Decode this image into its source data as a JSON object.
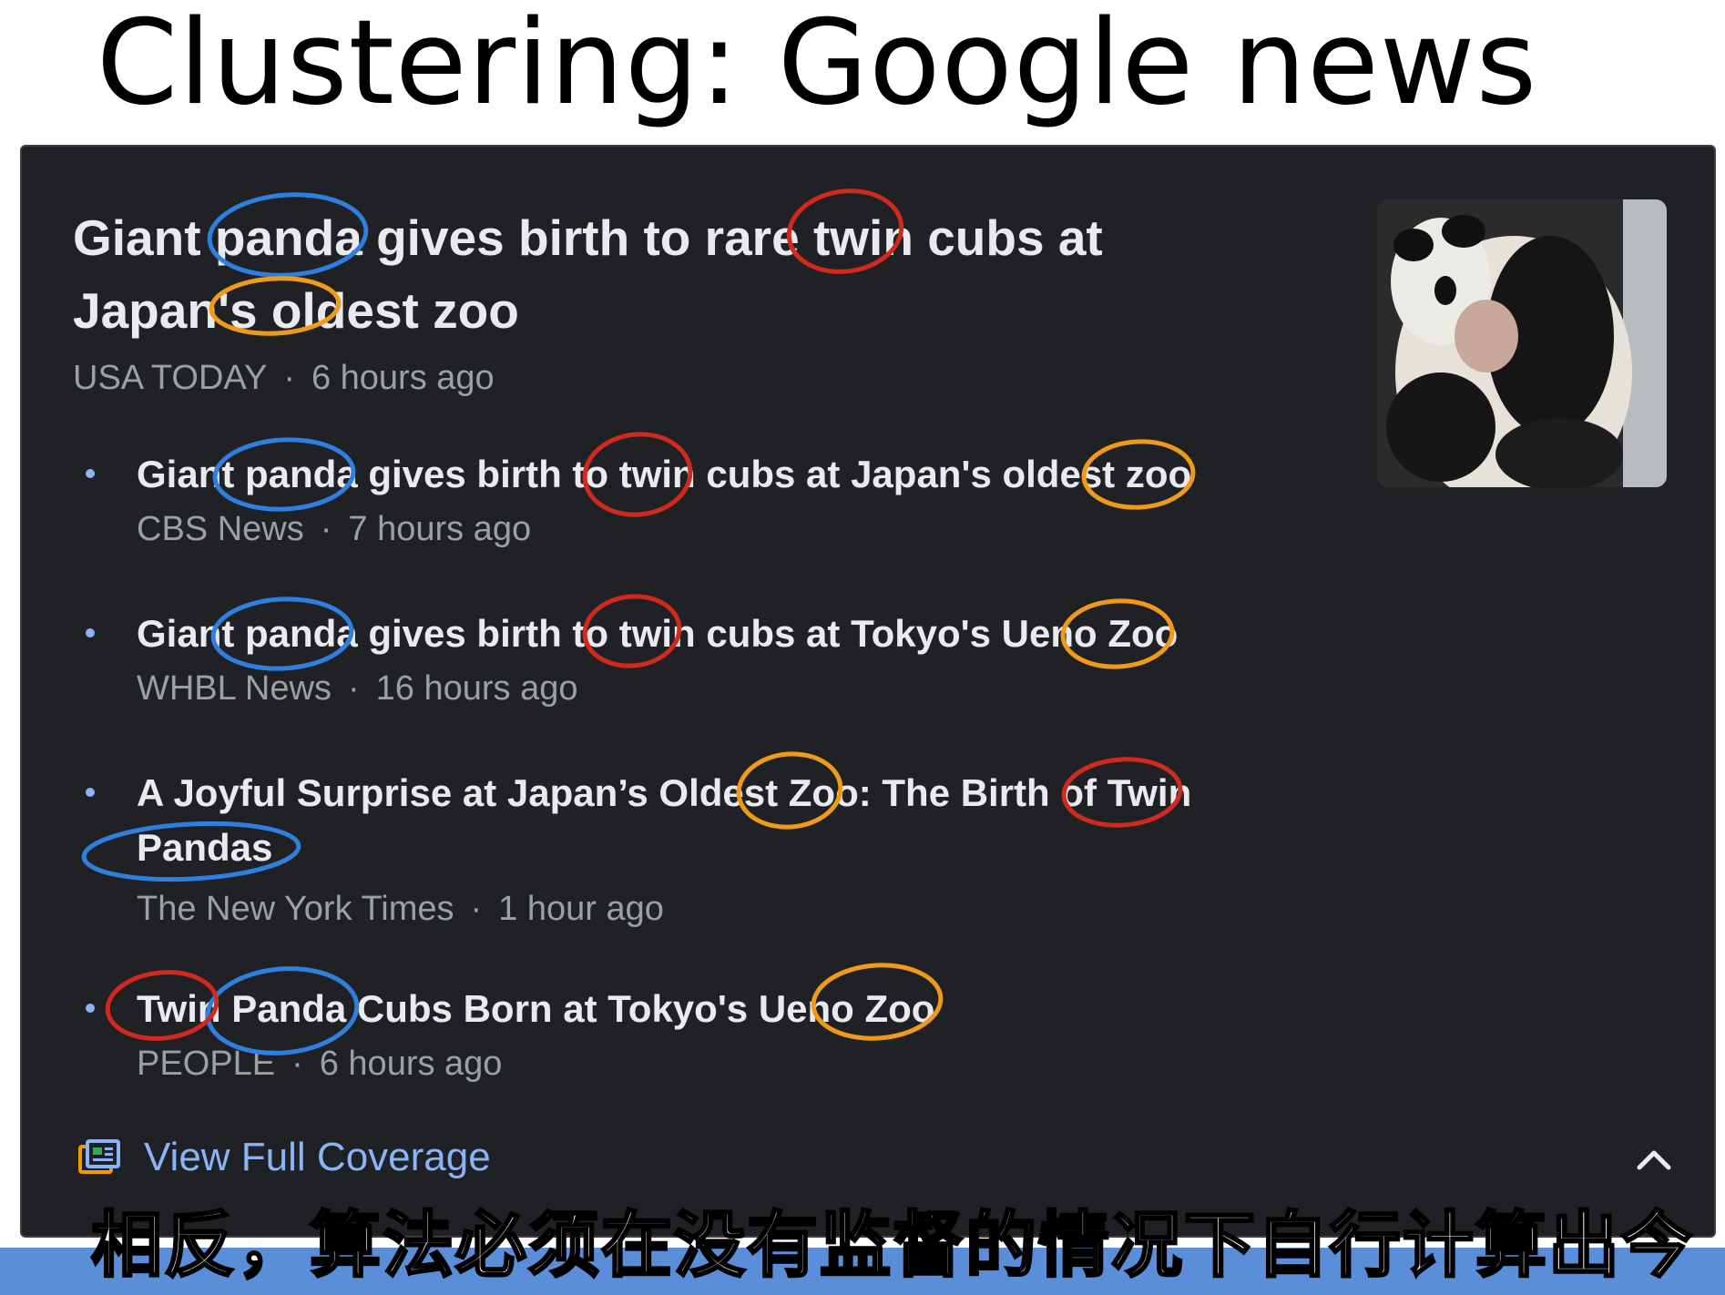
{
  "slide": {
    "title": "Clustering: Google news"
  },
  "card": {
    "headline": "Giant panda gives birth to rare twin cubs at Japan's oldest zoo",
    "source": "USA TODAY",
    "time": "6 hours ago",
    "thumbnail_icon": "panda-photo",
    "stories": [
      {
        "title": "Giant panda gives birth to twin cubs at Japan's oldest zoo",
        "source": "CBS News",
        "time": "7 hours ago"
      },
      {
        "title": "Giant panda gives birth to twin cubs at Tokyo's Ueno Zoo",
        "source": "WHBL News",
        "time": "16 hours ago"
      },
      {
        "title": "A Joyful Surprise at Japan’s Oldest Zoo: The Birth of Twin Pandas",
        "source": "The New York Times",
        "time": "1 hour ago"
      },
      {
        "title": "Twin Panda Cubs Born at Tokyo's Ueno Zoo",
        "source": "PEOPLE",
        "time": "6 hours ago"
      }
    ],
    "coverage_label": "View Full Coverage",
    "coverage_icon": "full-coverage-icon",
    "collapse_icon": "chevron-up-icon"
  },
  "annotation_colors": {
    "panda": "#2f7fe0",
    "twin": "#d02a1f",
    "zoo": "#f09a1a"
  },
  "subtitle": "相反，算法必须在没有监督的情况下自行计算出今"
}
